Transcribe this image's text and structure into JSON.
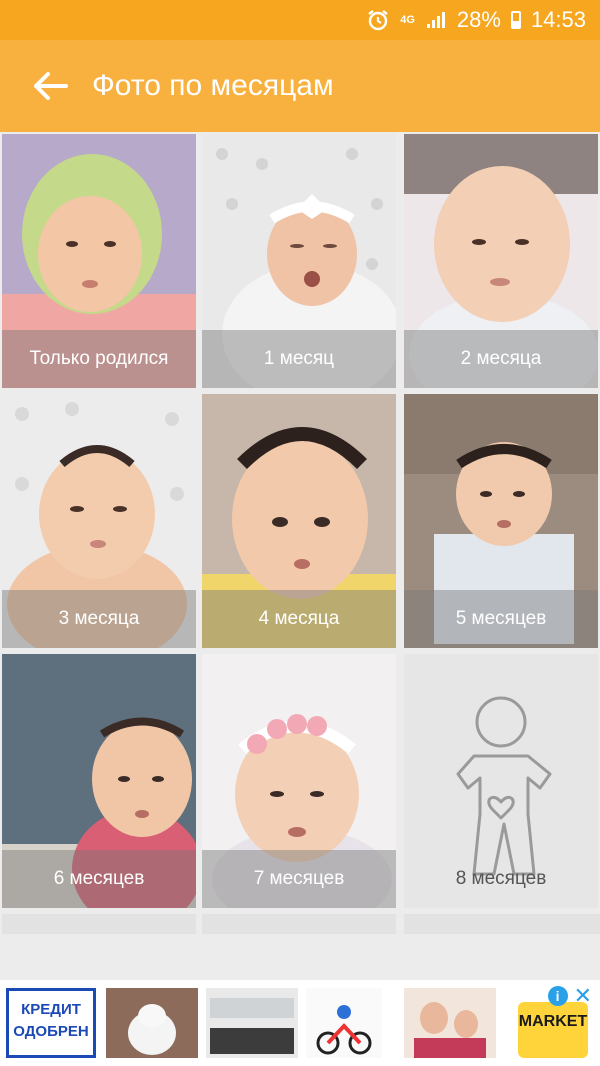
{
  "status_bar": {
    "net_label": "4G",
    "battery": "28%",
    "time": "14:53"
  },
  "app_bar": {
    "title": "Фото по месяцам"
  },
  "grid": {
    "tiles": [
      {
        "label": "Только родился"
      },
      {
        "label": "1 месяц"
      },
      {
        "label": "2 месяца"
      },
      {
        "label": "3 месяца"
      },
      {
        "label": "4 месяца"
      },
      {
        "label": "5 месяцев"
      },
      {
        "label": "6 месяцев"
      },
      {
        "label": "7 месяцев"
      },
      {
        "label": "8 месяцев"
      }
    ]
  },
  "ads": {
    "credit_text_1": "КРЕДИТ",
    "credit_text_2": "ОДОБРЕН",
    "market_label": "MARKET",
    "info_label": "i",
    "close_label": "✕"
  },
  "colors": {
    "status_bar": "#f6a71f",
    "app_bar": "#f8b13e",
    "background": "#ececec"
  }
}
